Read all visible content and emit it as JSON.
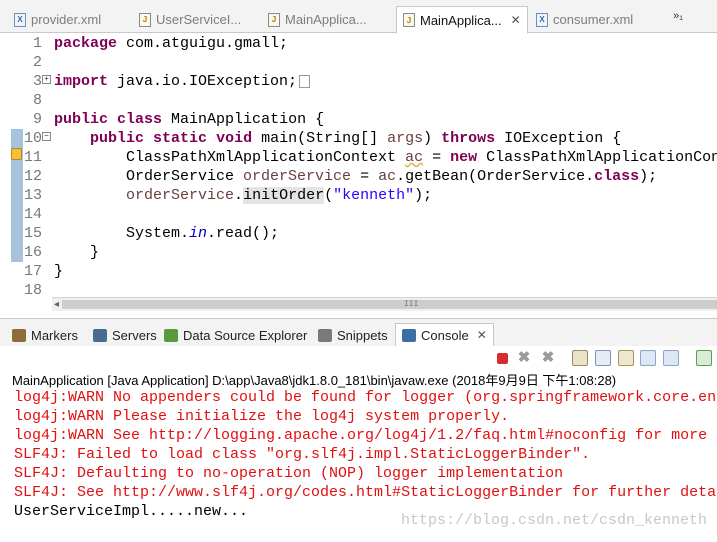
{
  "editor_tabs": [
    {
      "label": "provider.xml",
      "kind": "xml"
    },
    {
      "label": "UserServiceI...",
      "kind": "java"
    },
    {
      "label": "MainApplica...",
      "kind": "java"
    },
    {
      "label": "MainApplica...",
      "kind": "java",
      "active": true
    },
    {
      "label": "consumer.xml",
      "kind": "xml"
    }
  ],
  "active_tab_close": "✕",
  "tab_overflow": "»₁",
  "code_lines": [
    {
      "num": "1",
      "html": "<span class=\"kw\">package</span> com.atguigu.gmall;"
    },
    {
      "num": "2",
      "html": ""
    },
    {
      "num": "3",
      "html": "<span class=\"kw\">import</span> java.io.IOException;<span class=\"collapsed-box\"></span>"
    },
    {
      "num": "8",
      "html": ""
    },
    {
      "num": "9",
      "html": "<span class=\"kw\">public</span> <span class=\"kw\">class</span> MainApplication {"
    },
    {
      "num": "10",
      "html": "    <span class=\"kw\">public</span> <span class=\"kw\">static</span> <span class=\"kw\">void</span> main(String[] <span class=\"var\">args</span>) <span class=\"kw\">throws</span> IOException {"
    },
    {
      "num": "11",
      "html": "        ClassPathXmlApplicationContext <span class=\"var wavy\">ac</span> = <span class=\"kw\">new</span> ClassPathXmlApplicationCont"
    },
    {
      "num": "12",
      "html": "        OrderService <span class=\"var\">orderService</span> = <span class=\"var\">ac</span>.getBean(OrderService.<span class=\"kw\">class</span>);"
    },
    {
      "num": "13",
      "html": "        <span class=\"var\">orderService</span>.<span class=\"hl\">initOrder</span>(<span class=\"str\">\"kenneth\"</span>);"
    },
    {
      "num": "14",
      "html": ""
    },
    {
      "num": "15",
      "html": "        System.<span class=\"fld ital\">in</span>.read();"
    },
    {
      "num": "16",
      "html": "    }"
    },
    {
      "num": "17",
      "html": "}"
    },
    {
      "num": "18",
      "html": ""
    }
  ],
  "scroll_grip": "III",
  "view_tabs": [
    {
      "label": "Markers",
      "icon": "markers-icon",
      "color": "#8d6e3a"
    },
    {
      "label": "Servers",
      "icon": "servers-icon",
      "color": "#4b6b8f"
    },
    {
      "label": "Data Source Explorer",
      "icon": "data-source-icon",
      "color": "#5a9a3c"
    },
    {
      "label": "Snippets",
      "icon": "snippets-icon",
      "color": "#7a7a7a"
    },
    {
      "label": "Console",
      "icon": "console-icon",
      "color": "#3a6ea5",
      "active": true
    }
  ],
  "console_close": "✕",
  "console_title": "MainApplication [Java Application] D:\\app\\Java8\\jdk1.8.0_181\\bin\\javaw.exe (2018年9月9日 下午1:08:28)",
  "console_lines": [
    {
      "text": "log4j:WARN No appenders could be found for logger (org.springframework.core.en",
      "type": "err"
    },
    {
      "text": "log4j:WARN Please initialize the log4j system properly.",
      "type": "err"
    },
    {
      "text": "log4j:WARN See http://logging.apache.org/log4j/1.2/faq.html#noconfig for more",
      "type": "err"
    },
    {
      "text": "SLF4J: Failed to load class \"org.slf4j.impl.StaticLoggerBinder\".",
      "type": "err"
    },
    {
      "text": "SLF4J: Defaulting to no-operation (NOP) logger implementation",
      "type": "err"
    },
    {
      "text": "SLF4J: See http://www.slf4j.org/codes.html#StaticLoggerBinder for further deta",
      "type": "err"
    },
    {
      "text": "UserServiceImpl.....new...",
      "type": "out"
    }
  ],
  "watermark": "https://blog.csdn.net/csdn_kenneth",
  "colors": {
    "error_text": "#e01010",
    "keyword": "#7f0055",
    "string": "#2a00ff",
    "field": "#0000c0"
  }
}
